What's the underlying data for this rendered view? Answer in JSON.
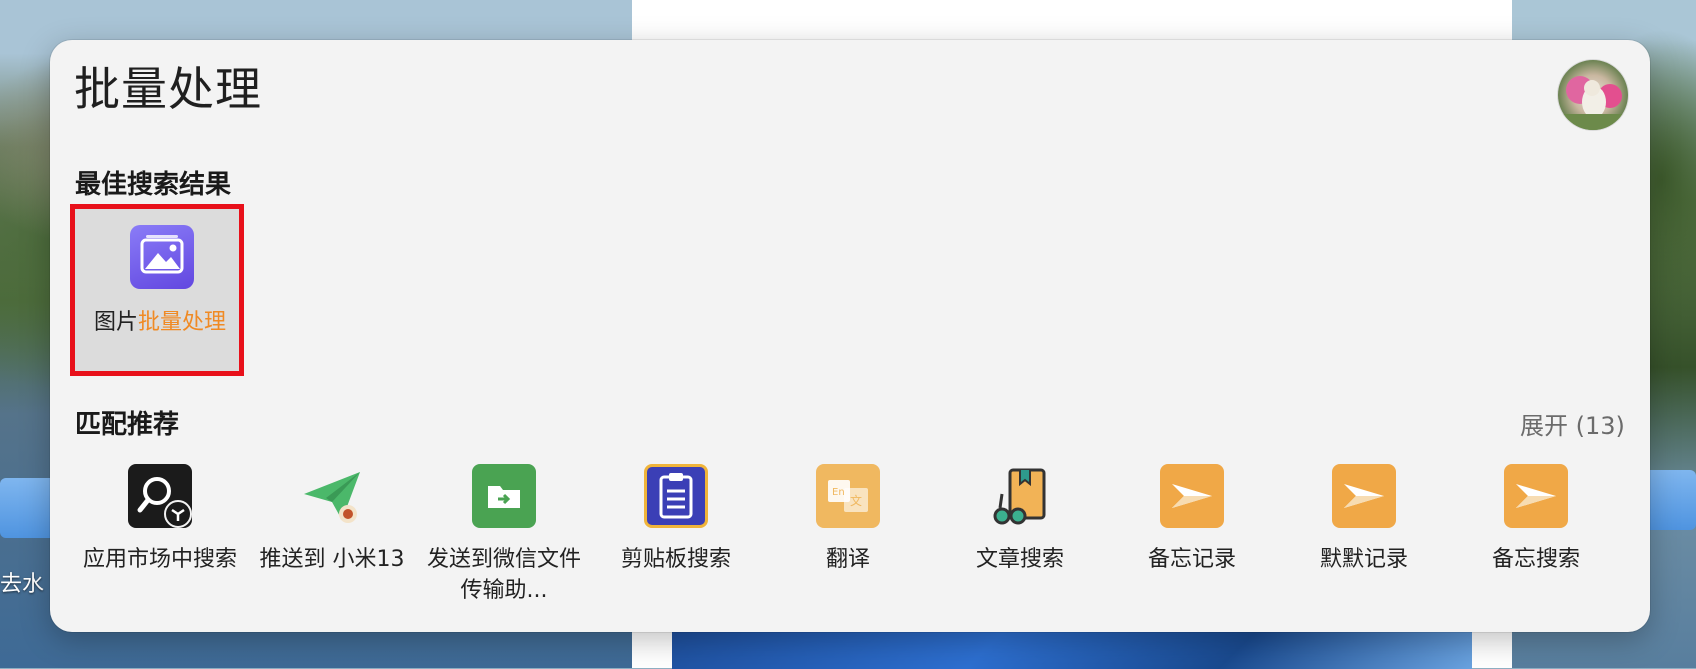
{
  "desktop": {
    "partial_text": "去水"
  },
  "search": {
    "query": "批量处理"
  },
  "best": {
    "section_title": "最佳搜索结果",
    "item": {
      "label_prefix": "图片",
      "label_highlight": "批量处理",
      "icon": "image-batch-icon",
      "highlight_color": "#f08a24",
      "selected_border_color": "#e8101a"
    }
  },
  "recommend": {
    "section_title": "匹配推荐",
    "expand_label": "展开 (13)",
    "items": [
      {
        "label": "应用市场中搜索",
        "icon": "app-market-search-icon"
      },
      {
        "label": "推送到 小米13",
        "icon": "paper-plane-icon"
      },
      {
        "label": "发送到微信文件传输助...",
        "icon": "wechat-file-transfer-icon"
      },
      {
        "label": "剪贴板搜索",
        "icon": "clipboard-icon"
      },
      {
        "label": "翻译",
        "icon": "translate-icon"
      },
      {
        "label": "文章搜索",
        "icon": "article-search-icon"
      },
      {
        "label": "备忘记录",
        "icon": "memo-icon"
      },
      {
        "label": "默默记录",
        "icon": "memo-icon"
      },
      {
        "label": "备忘搜索",
        "icon": "memo-icon"
      }
    ]
  }
}
